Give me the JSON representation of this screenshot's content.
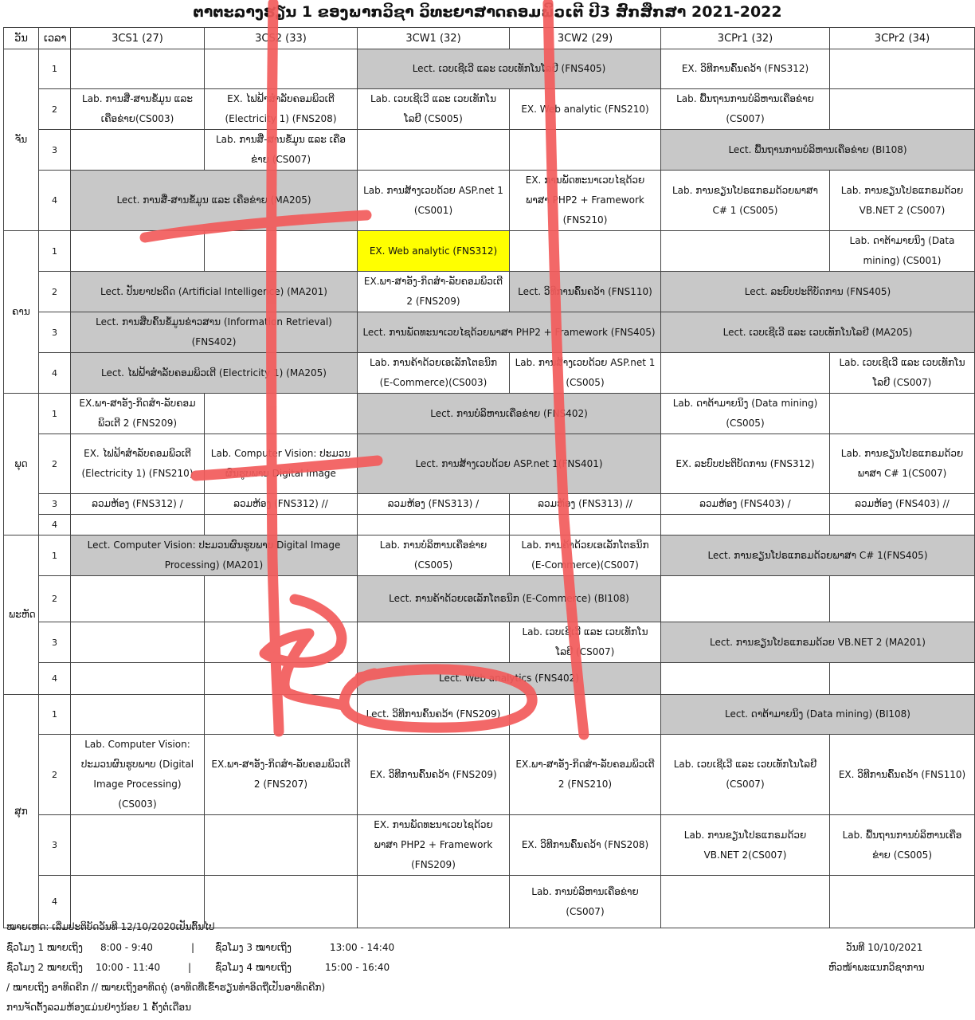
{
  "title": "ຕາຕະລາງຮຽນ 1 ຂອງພາກວິຊາ ວິທະຍາສາດຄອມພິວເຕີ ປີ3  ສົກສຶກສາ 2021-2022",
  "headers": [
    "ວັນ",
    "ເວລາ",
    "3CS1 (27)",
    "3CS2 (33)",
    "3CW1 (32)",
    "3CW2 (29)",
    "3CPr1 (32)",
    "3CPr2 (34)"
  ],
  "days": [
    "ຈັນ",
    "ຄານ",
    "ພຸດ",
    "ພະຫັດ",
    "ສຸກ"
  ],
  "periods": [
    "1",
    "2",
    "3",
    "4"
  ],
  "cells": {
    "mon1_cw": "Lect. ເວບເຊີເວີ ແລະ ເວບເທັກໂນໂລຢີ (FNS405)",
    "mon1_pr1": "EX. ວິທີການຄົ້ນຄວ້າ (FNS312)",
    "mon2_cs1": "Lab. ການສື່-ສານຂໍ້ມູນ ແລະ ເຄືອຂ່າຍ(CS003)",
    "mon2_cs2": "EX. ໄຟຟ້າສຳລັບຄອມພິວເຕີ (Electricity 1) (FNS208)",
    "mon2_cw1": "Lab. ເວບເຊີເວີ ແລະ ເວບເທັກໂນໂລຢີ (CS005)",
    "mon2_cw2": "EX. Web analytic (FNS210)",
    "mon2_pr1": "Lab. ພື້ນຖານການບໍລິຫານເຄືອຂ່າຍ (CS007)",
    "mon3_cs2": "Lab. ການສື່-ສານຂໍ້ມູນ ແລະ ເຄືອຂ່າຍ (CS007)",
    "mon3_pr": "Lect. ພື້ນຖານການບໍລິຫານເຄືອຂ່າຍ (BI108)",
    "mon4_cs": "Lect. ການສື່-ສານຂໍ້ມູນ ແລະ ເຄືອຂ່າຍ (MA205)",
    "mon4_cw1": "Lab. ການສ້າງເວບດ້ວຍ ASP.net 1 (CS001)",
    "mon4_cw2": "EX. ການພັດທະນາເວບໄຊດ້ວຍພາສາ PHP2 + Framework (FNS210)",
    "mon4_pr1": "Lab. ການຂຽນໂປຣແກຣມດ້ວຍພາສາ C# 1 (CS005)",
    "mon4_pr2": "Lab. ການຂຽນໂປຣແກຣມດ້ວຍ VB.NET 2 (CS007)",
    "tue1_cw1": "EX. Web analytic (FNS312)",
    "tue1_pr2": "Lab. ດາຕ້າມາຍນິງ (Data mining) (CS001)",
    "tue2_cs": "Lect. ປັນຍາປະດິດ (Artificial Intelligence) (MA201)",
    "tue2_cw1": "EX.ພາ-ສາອັງ-ກິດສຳ-ລັບຄອມພິວເຕີ 2 (FNS209)",
    "tue2_cw2": "Lect. ວິທີການຄົ້ນຄວ້າ (FNS110)",
    "tue2_pr": "Lect. ລະບົບປະຕິບັດການ (FNS405)",
    "tue3_cs": "Lect. ການສືບຄົ້ນຂໍ້ມູນຂ່າວສານ (Information Retrieval) (FNS402)",
    "tue3_cw": "Lect. ການພັດທະນາເວບໄຊດ້ວຍພາສາ PHP2 + Framework (FNS405)",
    "tue3_pr": "Lect. ເວບເຊີເວີ ແລະ ເວບເທັກໂນໂລຢີ (MA205)",
    "tue4_cs": "Lect. ໄຟຟ້າສຳລັບຄອມພິວເຕີ (Electricity 1) (MA205)",
    "tue4_cw1": "Lab. ການຄ້າດ້ວຍເອເລັກໂຕຣນິກ (E-Commerce)(CS003)",
    "tue4_cw2": "Lab. ການສ້າງເວບດ້ວຍ ASP.net 1 (CS005)",
    "tue4_pr2": "Lab. ເວບເຊີເວີ ແລະ ເວບເທັກໂນໂລຢີ (CS007)",
    "wed1_cs1": "EX.ພາ-ສາອັງ-ກິດສຳ-ລັບຄອມພິວເຕີ 2 (FNS209)",
    "wed1_cw": "Lect. ການບໍລິຫານເຄືອຂ່າຍ (FNS402)",
    "wed1_pr1": "Lab. ດາຕ້າມາຍນິງ (Data mining) (CS005)",
    "wed2_cs1": "EX. ໄຟຟ້າສຳລັບຄອມພິວເຕີ (Electricity 1) (FNS210)",
    "wed2_cs2": "Lab. Computer Vision: ປະມວນຜົນຮູບພາບ Digital Image",
    "wed2_cw": "Lect. ການສ້າງເວບດ້ວຍ ASP.net 1(FNS401)",
    "wed2_pr1": "EX. ລະບົບປະຕິບັດການ (FNS312)",
    "wed2_pr2": "Lab. ການຂຽນໂປຣແກຣມດ້ວຍພາສາ C# 1(CS007)",
    "wed3_cs1": "ລວມຫ້ອງ (FNS312) /",
    "wed3_cs2": "ລວມຫ້ອງ (FNS312) //",
    "wed3_cw1": "ລວມຫ້ອງ (FNS313) /",
    "wed3_cw2": "ລວມຫ້ອງ (FNS313) //",
    "wed3_pr1": "ລວມຫ້ອງ (FNS403) /",
    "wed3_pr2": "ລວມຫ້ອງ (FNS403) //",
    "thu1_cs": "Lect. Computer Vision: ປະມວນຜົນຮູບພາບ Digital Image Processing) (MA201)",
    "thu1_cw1": "Lab. ການບໍລິຫານເຄືອຂ່າຍ (CS005)",
    "thu1_cw2": "Lab. ການຄ້າດ້ວຍເອເລັກໂຕຣນິກ (E-Commerce)(CS007)",
    "thu1_pr": "Lect. ການຂຽນໂປຣແກຣມດ້ວຍພາສາ C# 1(FNS405)",
    "thu2_cw": "Lect. ການຄ້າດ້ວຍເອເລັກໂຕຣນິກ (E-Commerce) (BI108)",
    "thu3_cw2": "Lab. ເວບເຊີເວີ ແລະ ເວບເທັກໂນໂລຢີ (CS007)",
    "thu3_pr": "Lect. ການຂຽນໂປຣແກຣມດ້ວຍ VB.NET 2 (MA201)",
    "thu4_cw": "Lect. Web analytics (FNS402)",
    "fri1_cw1": "Lect. ວິທີການຄົ້ນຄວ້າ (FNS209)",
    "fri1_pr": "Lect. ດາຕ້າມາຍນິງ (Data mining) (BI108)",
    "fri2_cs1": "Lab. Computer Vision: ປະມວນຜົນຮູບພາບ (Digital Image Processing) (CS003)",
    "fri2_cs2": "EX.ພາ-ສາອັງ-ກິດສຳ-ລັບຄອມພິວເຕີ 2 (FNS207)",
    "fri2_cw1": "EX. ວິທີການຄົ້ນຄວ້າ (FNS209)",
    "fri2_cw2": "EX.ພາ-ສາອັງ-ກິດສຳ-ລັບຄອມພິວເຕີ 2 (FNS210)",
    "fri2_pr1": "Lab. ເວບເຊີເວີ ແລະ ເວບເທັກໂນໂລຢີ (CS007)",
    "fri2_pr2": "EX. ວິທີການຄົ້ນຄວ້າ (FNS110)",
    "fri3_cw1": "EX. ການພັດທະນາເວບໄຊດ້ວຍພາສາ PHP2 + Framework (FNS209)",
    "fri3_cw2": "EX. ວິທີການຄົ້ນຄວ້າ (FNS208)",
    "fri3_pr1": "Lab. ການຂຽນໂປຣແກຣມດ້ວຍ VB.NET 2(CS007)",
    "fri3_pr2": "Lab. ພື້ນຖານການບໍລິຫານເຄືອຂ່າຍ (CS005)",
    "fri4_cw2": "Lab. ການບໍລິຫານເຄືອຂ່າຍ (CS007)"
  },
  "notes": {
    "start": "ໝາຍເຫດ: ເລີ່ມປະຕິບັດວັນທີ 12/10/2020ເປັນຕົ້ນໄປ",
    "p1_label": "ຊົ່ວໂມງ 1 ໝາຍເຖິງ",
    "p1_time": "8:00 - 9:40",
    "p3_label": "ຊົ່ວໂມງ 3 ໝາຍເຖິງ",
    "p3_time": "13:00 - 14:40",
    "p2_label": "ຊົ່ວໂມງ 2 ໝາຍເຖິງ",
    "p2_time": "10:00 - 11:40",
    "p4_label": "ຊົ່ວໂມງ 4 ໝາຍເຖິງ",
    "p4_time": "15:00 - 16:40",
    "sep": "|",
    "weeks": "/  ໝາຍເຖິງ ອາທິດຄີກ    // ໝາຍເຖິງອາທິດຄູ່ (ອາທິດທີ່ເຂົ້າຮຽນທຳອິດຖືເປັນອາທິດຄີກ)",
    "monthly": "ການຈັດຕັ້ງລວມຫ້ອງແມ່ນຢ່າງນ້ອຍ  1 ຄັ້ງຕໍ່ເດືອນ",
    "date": "ວັນທີ 10/10/2021",
    "head": "ຫົວໜ້າພະແນກວິຊາການ"
  },
  "colors": {
    "grey_cell": "#c8c8c8",
    "yellow_cell": "#ffff00",
    "annotation": "#f25b5b"
  }
}
